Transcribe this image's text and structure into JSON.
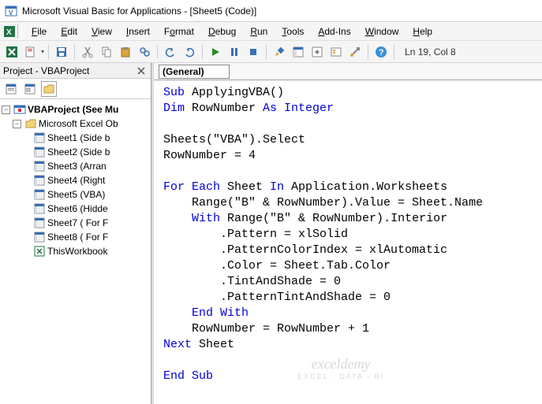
{
  "title": "Microsoft Visual Basic for Applications - [Sheet5 (Code)]",
  "menu": {
    "file": "File",
    "edit": "Edit",
    "view": "View",
    "insert": "Insert",
    "format": "Format",
    "debug": "Debug",
    "run": "Run",
    "tools": "Tools",
    "addins": "Add-Ins",
    "window": "Window",
    "help": "Help"
  },
  "status": {
    "pos": "Ln 19, Col 8"
  },
  "project": {
    "title": "Project - VBAProject",
    "root": "VBAProject (See Mu",
    "folder": "Microsoft Excel Ob",
    "sheets": [
      "Sheet1 (Side b",
      "Sheet2 (Side b",
      "Sheet3 (Arran",
      "Sheet4 (Right",
      "Sheet5 (VBA)",
      "Sheet6 (Hidde",
      "Sheet7 ( For F",
      "Sheet8 ( For F"
    ],
    "workbook": "ThisWorkbook"
  },
  "codeheader": {
    "left": "(General)"
  },
  "code": {
    "l1a": "Sub ",
    "l1b": "ApplyingVBA()",
    "l2a": "Dim ",
    "l2b": "RowNumber ",
    "l2c": "As Integer",
    "l3": "",
    "l4": "Sheets(\"VBA\").Select",
    "l5": "RowNumber = 4",
    "l6": "",
    "l7a": "For Each ",
    "l7b": "Sheet ",
    "l7c": "In ",
    "l7d": "Application.Worksheets",
    "l8": "    Range(\"B\" & RowNumber).Value = Sheet.Name",
    "l9a": "    ",
    "l9b": "With ",
    "l9c": "Range(\"B\" & RowNumber).Interior",
    "l10": "        .Pattern = xlSolid",
    "l11": "        .PatternColorIndex = xlAutomatic",
    "l12": "        .Color = Sheet.Tab.Color",
    "l13": "        .TintAndShade = 0",
    "l14": "        .PatternTintAndShade = 0",
    "l15a": "    ",
    "l15b": "End With",
    "l16": "    RowNumber = RowNumber + 1",
    "l17a": "Next ",
    "l17b": "Sheet",
    "l18": "",
    "l19": "End Sub"
  },
  "watermark": {
    "main": "exceldemy",
    "sub": "EXCEL · DATA · BI"
  }
}
